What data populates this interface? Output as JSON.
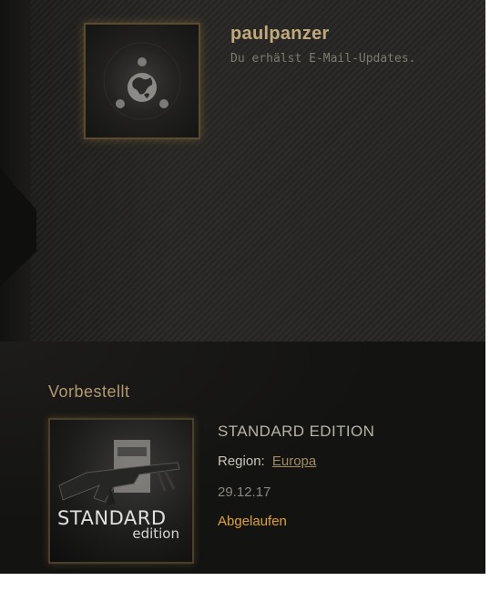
{
  "profile": {
    "username": "paulpanzer",
    "email_status": "Du erhälst E-Mail-Updates.",
    "avatar_icon": "globe-emblem-icon"
  },
  "preorders": {
    "section_title": "Vorbestellt",
    "items": [
      {
        "image_text_line1": "STANDARD",
        "image_text_line2": "edition",
        "name": "STANDARD EDITION",
        "region_label": "Region:",
        "region_value": "Europa",
        "date": "29.12.17",
        "status": "Abgelaufen"
      }
    ]
  },
  "colors": {
    "accent_gold": "#c0aa7c",
    "status_orange": "#e0a526",
    "background": "#151514"
  }
}
